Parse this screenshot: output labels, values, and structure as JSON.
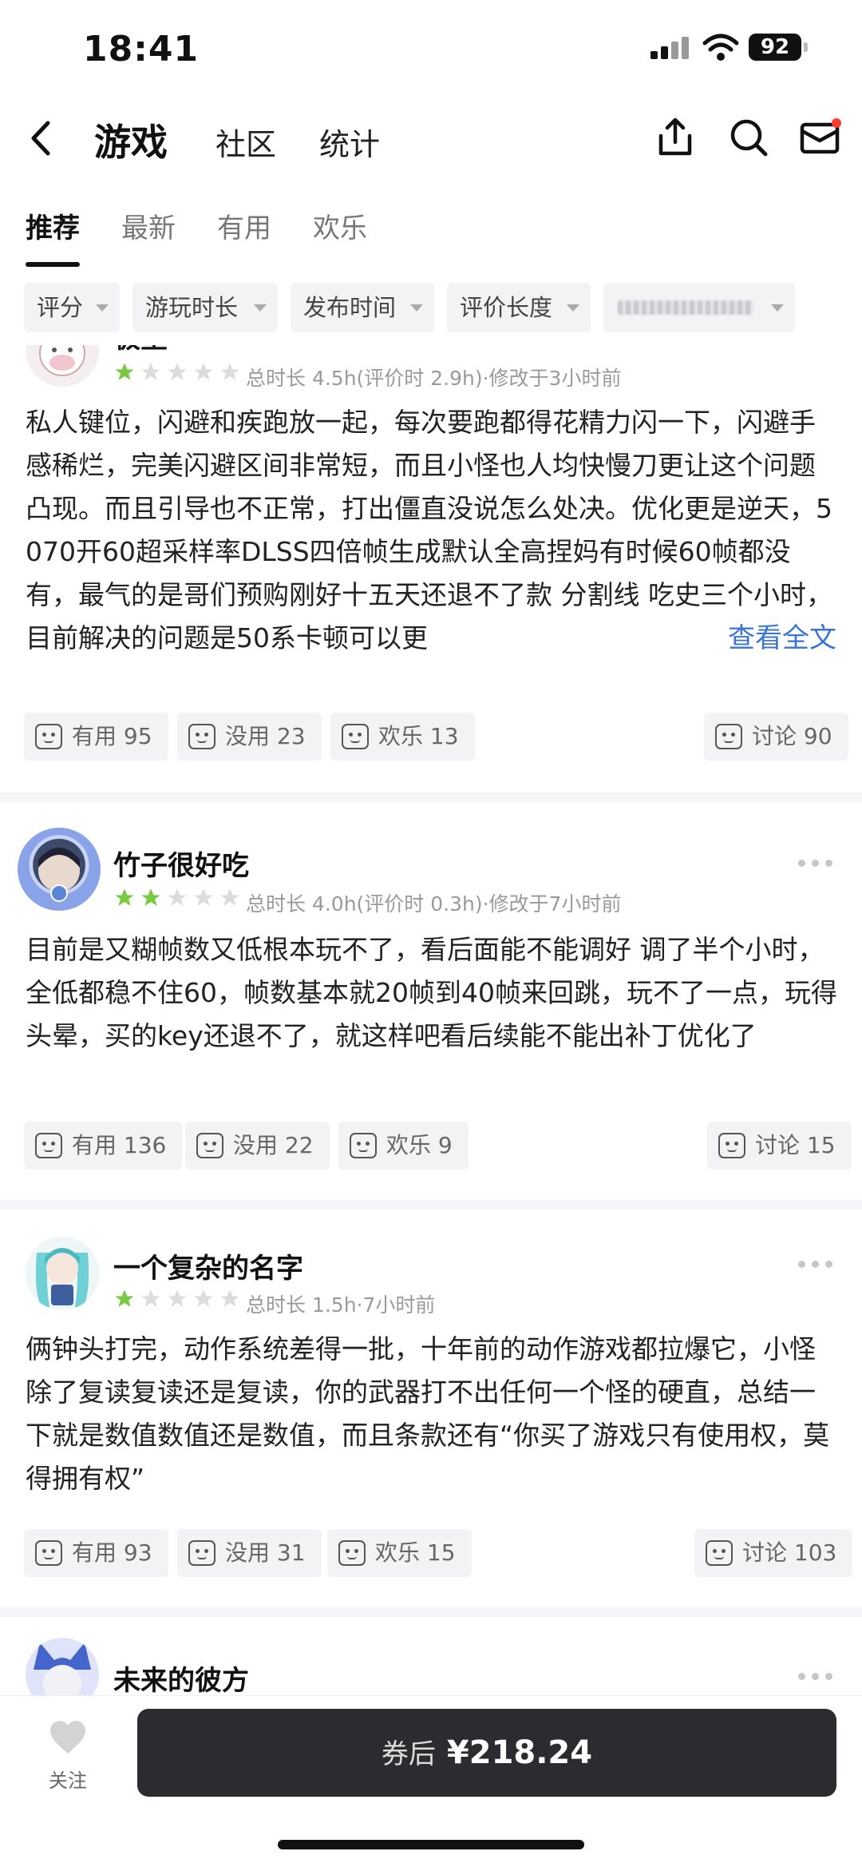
{
  "status_bar": {
    "time": "18:41",
    "battery": "92"
  },
  "header": {
    "title": "游戏",
    "tabs": [
      "社区",
      "统计"
    ],
    "icons": [
      "back-icon",
      "share-icon",
      "search-icon",
      "mail-icon"
    ],
    "notification_dot_color": "#ff3b30"
  },
  "subtabs": {
    "items": [
      "推荐",
      "最新",
      "有用",
      "欢乐"
    ],
    "active": "推荐"
  },
  "filters": [
    "评分",
    "游玩时长",
    "发布时间",
    "评价长度"
  ],
  "reviews": [
    {
      "user": "极望",
      "rating": 1,
      "meta": "总时长 4.5h(评价时 2.9h)·修改于3小时前",
      "text": "私人键位，闪避和疾跑放一起，每次要跑都得花精力闪一下，闪避手感稀烂，完美闪避区间非常短，而且小怪也人均快慢刀更让这个问题凸现。而且引导也不正常，打出僵直没说怎么处决。优化更是逆天，5070开60超采样率DLSS四倍帧生成默认全高捏妈有时候60帧都没有，最气的是哥们预购刚好十五天还退不了款 分割线 吃史三个小时，目前解决的问题是50系卡顿可以更",
      "read_more": "查看全文",
      "useful": "有用 95",
      "useless": "没用 23",
      "fun": "欢乐 13",
      "discuss": "讨论 90"
    },
    {
      "user": "竹子很好吃",
      "rating": 2,
      "meta": "总时长 4.0h(评价时 0.3h)·修改于7小时前",
      "text": "目前是又糊帧数又低根本玩不了，看后面能不能调好 调了半个小时，全低都稳不住60，帧数基本就20帧到40帧来回跳，玩不了一点，玩得头晕，买的key还退不了，就这样吧看后续能不能出补丁优化了",
      "useful": "有用 136",
      "useless": "没用 22",
      "fun": "欢乐 9",
      "discuss": "讨论 15"
    },
    {
      "user": "一个复杂的名字",
      "rating": 1,
      "meta": "总时长 1.5h·7小时前",
      "text": "俩钟头打完，动作系统差得一批，十年前的动作游戏都拉爆它，小怪除了复读复读还是复读，你的武器打不出任何一个怪的硬直，总结一下就是数值数值还是数值，而且条款还有“你买了游戏只有使用权，莫得拥有权”",
      "useful": "有用 93",
      "useless": "没用 31",
      "fun": "欢乐 15",
      "discuss": "讨论 103"
    },
    {
      "user": "未来的彼方"
    }
  ],
  "star_color_on": "#7ac943",
  "star_color_off": "#dcdcdc",
  "bottom": {
    "follow_label": "关注",
    "buy_prefix": "券后",
    "price": "¥218.24"
  }
}
